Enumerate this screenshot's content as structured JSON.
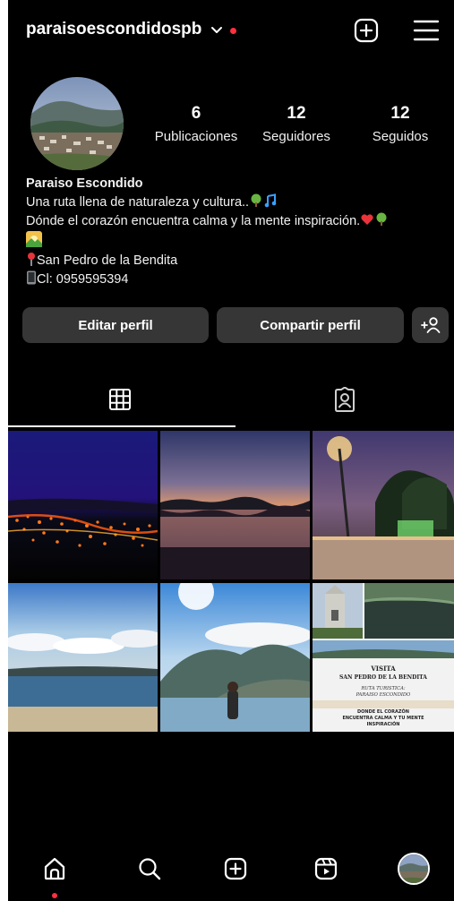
{
  "header": {
    "username": "paraisoescondidospb",
    "icons": [
      "chevron-down-icon",
      "notification-dot",
      "add-square-icon",
      "hamburger-menu-icon"
    ]
  },
  "profile": {
    "stats": {
      "posts": {
        "value": "6",
        "label": "Publicaciones"
      },
      "followers": {
        "value": "12",
        "label": "Seguidores"
      },
      "following": {
        "value": "12",
        "label": "Seguidos"
      }
    },
    "bio": {
      "name": "Paraiso Escondido",
      "line1": "Una ruta llena de naturaleza y cultura..",
      "line2": "Dónde el corazón encuentra calma y la mente inspiración.",
      "location": "San Pedro de la Bendita",
      "contact": "Cl: 0959595394"
    }
  },
  "buttons": {
    "edit": "Editar perfil",
    "share": "Compartir perfil",
    "add_user_icon": "add-person-icon"
  },
  "tabs": [
    {
      "name": "posts-grid",
      "icon": "grid-icon",
      "active": true
    },
    {
      "name": "tagged",
      "icon": "tagged-person-icon",
      "active": false
    }
  ],
  "posts": {
    "tile6_text": {
      "visit": "VISITA",
      "place": "SAN PEDRO DE LA BENDITA",
      "route1": "RUTA TURISTICA:",
      "route2": "PARAISO ESCONDIDO",
      "slogan1": "DONDE EL CORAZÓN",
      "slogan2": "ENCUENTRA CALMA Y TU MENTE",
      "slogan3": "INSPIRACIÓN"
    }
  },
  "bottom_nav": [
    "home-icon",
    "search-icon",
    "create-icon",
    "reels-icon",
    "profile-avatar"
  ],
  "colors": {
    "background": "#000000",
    "button": "#363636",
    "notification": "#ff3040",
    "text": "#f5f5f5"
  }
}
